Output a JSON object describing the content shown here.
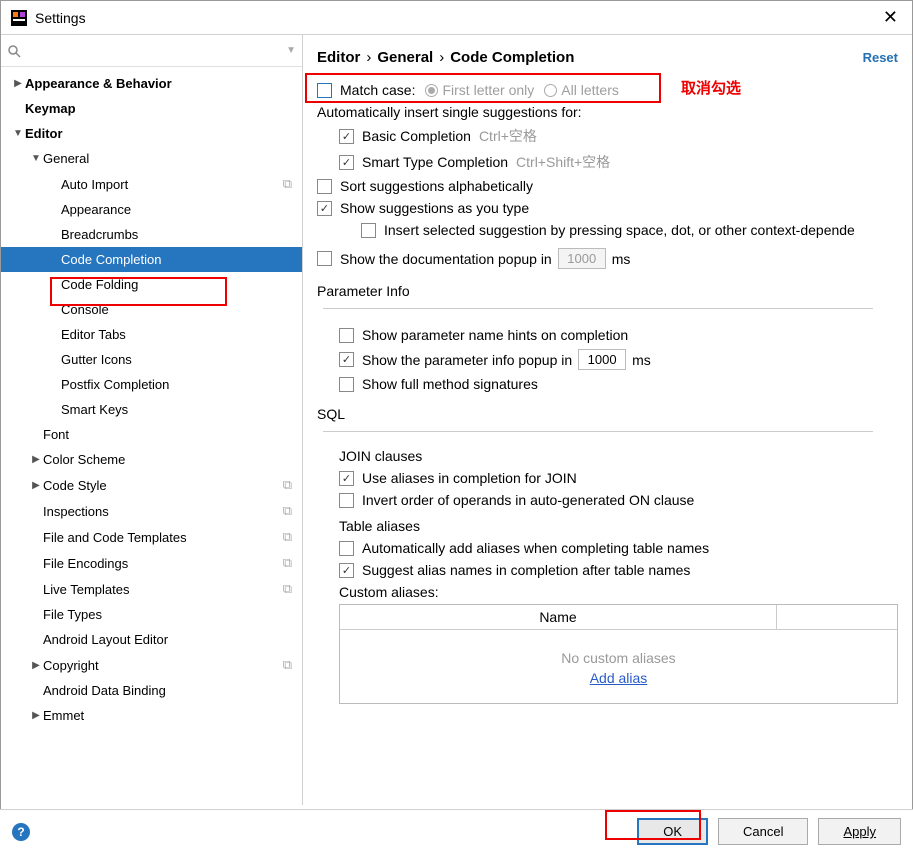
{
  "window": {
    "title": "Settings"
  },
  "search": {
    "placeholder": ""
  },
  "tree": [
    {
      "label": "Appearance & Behavior",
      "depth": 0,
      "arrow": "right",
      "bold": true
    },
    {
      "label": "Keymap",
      "depth": 0,
      "arrow": "none",
      "bold": true
    },
    {
      "label": "Editor",
      "depth": 0,
      "arrow": "down",
      "bold": true
    },
    {
      "label": "General",
      "depth": 1,
      "arrow": "down"
    },
    {
      "label": "Auto Import",
      "depth": 2,
      "arrow": "none",
      "copy": true
    },
    {
      "label": "Appearance",
      "depth": 2,
      "arrow": "none"
    },
    {
      "label": "Breadcrumbs",
      "depth": 2,
      "arrow": "none"
    },
    {
      "label": "Code Completion",
      "depth": 2,
      "arrow": "none",
      "selected": true
    },
    {
      "label": "Code Folding",
      "depth": 2,
      "arrow": "none"
    },
    {
      "label": "Console",
      "depth": 2,
      "arrow": "none"
    },
    {
      "label": "Editor Tabs",
      "depth": 2,
      "arrow": "none"
    },
    {
      "label": "Gutter Icons",
      "depth": 2,
      "arrow": "none"
    },
    {
      "label": "Postfix Completion",
      "depth": 2,
      "arrow": "none"
    },
    {
      "label": "Smart Keys",
      "depth": 2,
      "arrow": "none"
    },
    {
      "label": "Font",
      "depth": 1,
      "arrow": "none"
    },
    {
      "label": "Color Scheme",
      "depth": 1,
      "arrow": "right"
    },
    {
      "label": "Code Style",
      "depth": 1,
      "arrow": "right",
      "copy": true
    },
    {
      "label": "Inspections",
      "depth": 1,
      "arrow": "none",
      "copy": true
    },
    {
      "label": "File and Code Templates",
      "depth": 1,
      "arrow": "none",
      "copy": true
    },
    {
      "label": "File Encodings",
      "depth": 1,
      "arrow": "none",
      "copy": true
    },
    {
      "label": "Live Templates",
      "depth": 1,
      "arrow": "none",
      "copy": true
    },
    {
      "label": "File Types",
      "depth": 1,
      "arrow": "none"
    },
    {
      "label": "Android Layout Editor",
      "depth": 1,
      "arrow": "none"
    },
    {
      "label": "Copyright",
      "depth": 1,
      "arrow": "right",
      "copy": true
    },
    {
      "label": "Android Data Binding",
      "depth": 1,
      "arrow": "none"
    },
    {
      "label": "Emmet",
      "depth": 1,
      "arrow": "right"
    }
  ],
  "breadcrumb": {
    "a": "Editor",
    "b": "General",
    "c": "Code Completion"
  },
  "reset": "Reset",
  "form": {
    "match_case": "Match case:",
    "first_letter": "First letter only",
    "all_letters": "All letters",
    "auto_insert_heading": "Automatically insert single suggestions for:",
    "basic": "Basic Completion",
    "basic_shortcut": "Ctrl+空格",
    "smart": "Smart Type Completion",
    "smart_shortcut": "Ctrl+Shift+空格",
    "sort": "Sort suggestions alphabetically",
    "show_type": "Show suggestions as you type",
    "insert_selected": "Insert selected suggestion by pressing space, dot, or other context-depende",
    "show_doc_a": "Show the documentation popup in",
    "show_doc_val": "1000",
    "ms": "ms",
    "param_heading": "Parameter Info",
    "param_hints": "Show parameter name hints on completion",
    "param_popup_a": "Show the parameter info popup in",
    "param_popup_val": "1000",
    "full_method": "Show full method signatures",
    "sql_heading": "SQL",
    "join_heading": "JOIN clauses",
    "use_aliases": "Use aliases in completion for JOIN",
    "invert_order": "Invert order of operands in auto-generated ON clause",
    "table_aliases_heading": "Table aliases",
    "auto_add": "Automatically add aliases when completing table names",
    "suggest_alias": "Suggest alias names in completion after table names",
    "custom_aliases": "Custom aliases:",
    "table_name_col": "Name",
    "no_custom": "No custom aliases",
    "add_alias": "Add alias"
  },
  "footer": {
    "ok": "OK",
    "cancel": "Cancel",
    "apply": "Apply"
  },
  "annotation": {
    "text": "取消勾选"
  }
}
